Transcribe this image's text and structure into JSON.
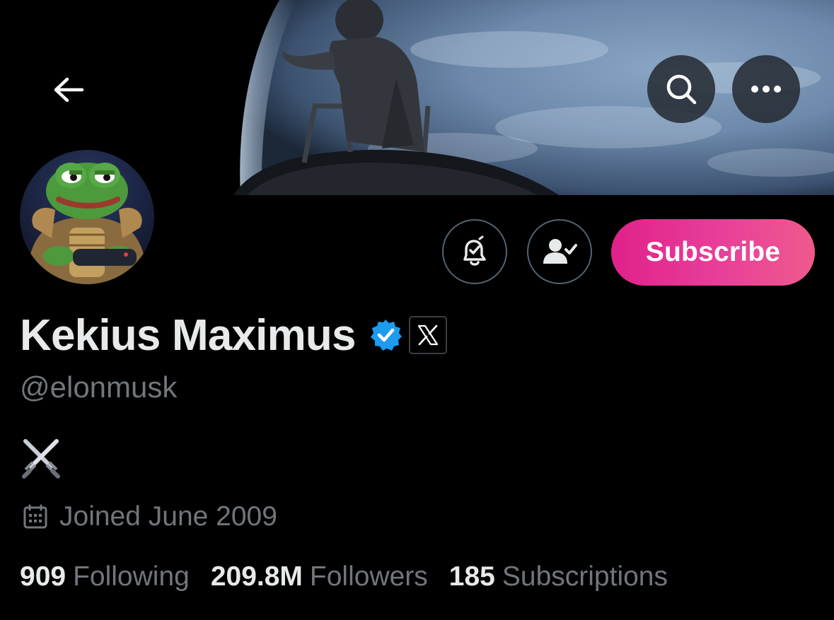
{
  "header": {
    "back_icon": "arrow-left-icon",
    "search_icon": "search-icon",
    "more_icon": "more-horizontal-icon"
  },
  "profile": {
    "display_name": "Kekius Maximus",
    "handle": "@elonmusk",
    "verified_badge_icon": "verified-badge-icon",
    "affiliate_badge_icon": "x-logo-icon",
    "bio_emoji": "⚔️",
    "joined": "Joined June 2009",
    "joined_icon": "calendar-icon"
  },
  "actions": {
    "notify_icon": "bell-check-icon",
    "following_icon": "person-check-icon",
    "subscribe_label": "Subscribe"
  },
  "stats": [
    {
      "value": "909",
      "label": "Following"
    },
    {
      "value": "209.8M",
      "label": "Followers"
    },
    {
      "value": "185",
      "label": "Subscriptions"
    }
  ],
  "colors": {
    "background": "#000000",
    "primary_text": "#e7e9ea",
    "secondary_text": "#71767b",
    "verified_blue": "#1d9bf0",
    "subscribe_gradient_start": "#e0218a",
    "subscribe_gradient_end": "#ee5a8c"
  }
}
